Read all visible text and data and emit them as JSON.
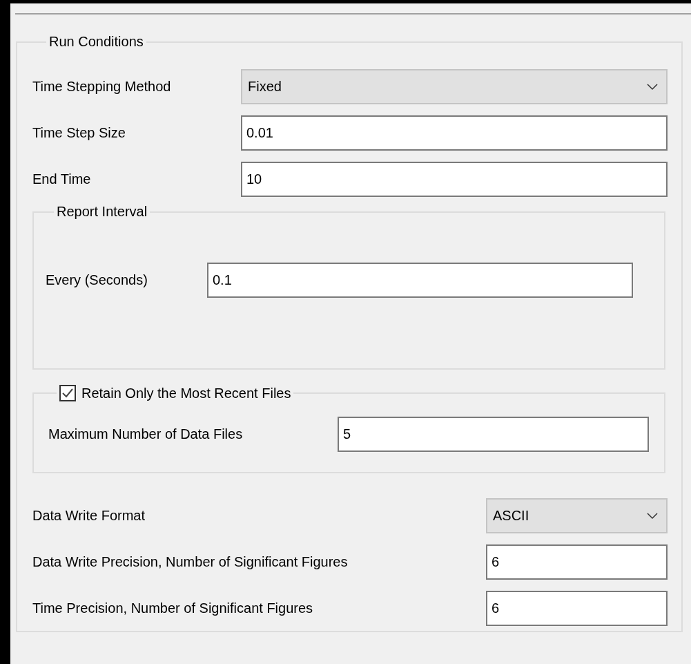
{
  "group": {
    "title": "Run Conditions"
  },
  "fields": [
    {
      "kind": "select",
      "label": "Time Stepping Method",
      "value": "Fixed"
    },
    {
      "kind": "input",
      "label": "Time Step Size",
      "value": "0.01"
    },
    {
      "kind": "input",
      "label": "End Time",
      "value": "10"
    }
  ],
  "report_interval": {
    "title": "Report Interval",
    "field": {
      "label": "Every (Seconds)",
      "value": "0.1"
    }
  },
  "retain": {
    "title": "Retain Only the Most Recent Files",
    "checked": true,
    "field": {
      "label": "Maximum Number of Data Files",
      "value": "5"
    }
  },
  "output_fields": [
    {
      "kind": "select",
      "label": "Data Write Format",
      "value": "ASCII"
    },
    {
      "kind": "input",
      "label": "Data Write Precision, Number of Significant Figures",
      "value": "6"
    },
    {
      "kind": "input",
      "label": "Time Precision, Number of Significant Figures",
      "value": "6"
    }
  ]
}
